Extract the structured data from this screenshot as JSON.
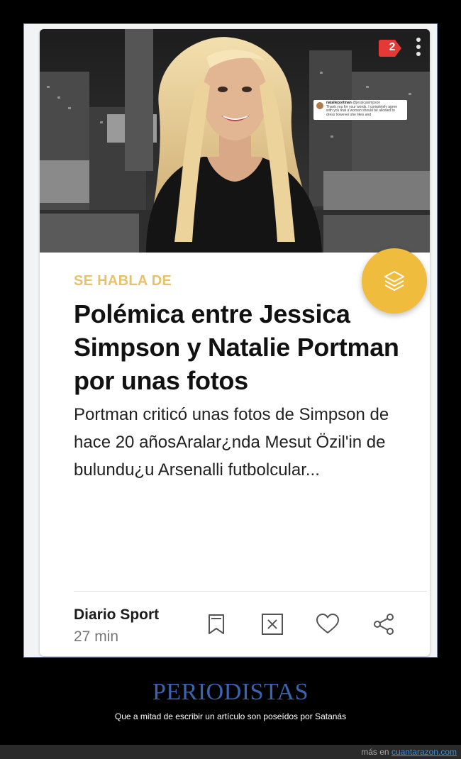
{
  "card": {
    "notification_count": "2",
    "kicker": "SE HABLA DE",
    "headline": "Polémica entre Jessica Simpson y Natalie Portman por unas fotos",
    "summary": "Portman criticó unas fotos de Simpson de hace 20 añosAralar¿nda Mesut Özil'in de bulundu¿u Arsenalli futbolcular...",
    "source": "Diario Sport",
    "time": "27 min",
    "instagram_post": {
      "user": "natalieportman",
      "mention": "@jessicasimpson",
      "text": "Thank you for your words. I completely agree with you that a woman should be allowed to dress however she likes and"
    },
    "actions": {
      "bookmark": "bookmark-icon",
      "dismiss": "close-box-icon",
      "like": "heart-icon",
      "share": "share-icon"
    },
    "colors": {
      "accent": "#efbc3d",
      "kicker": "#e8c26a",
      "badge": "#e53935"
    }
  },
  "caption": {
    "title": "PERIODISTAS",
    "subtitle": "Que a mitad de escribir un artículo son poseídos por Satanás"
  },
  "footer": {
    "prefix": "más en",
    "link": "cuantarazon.com"
  }
}
